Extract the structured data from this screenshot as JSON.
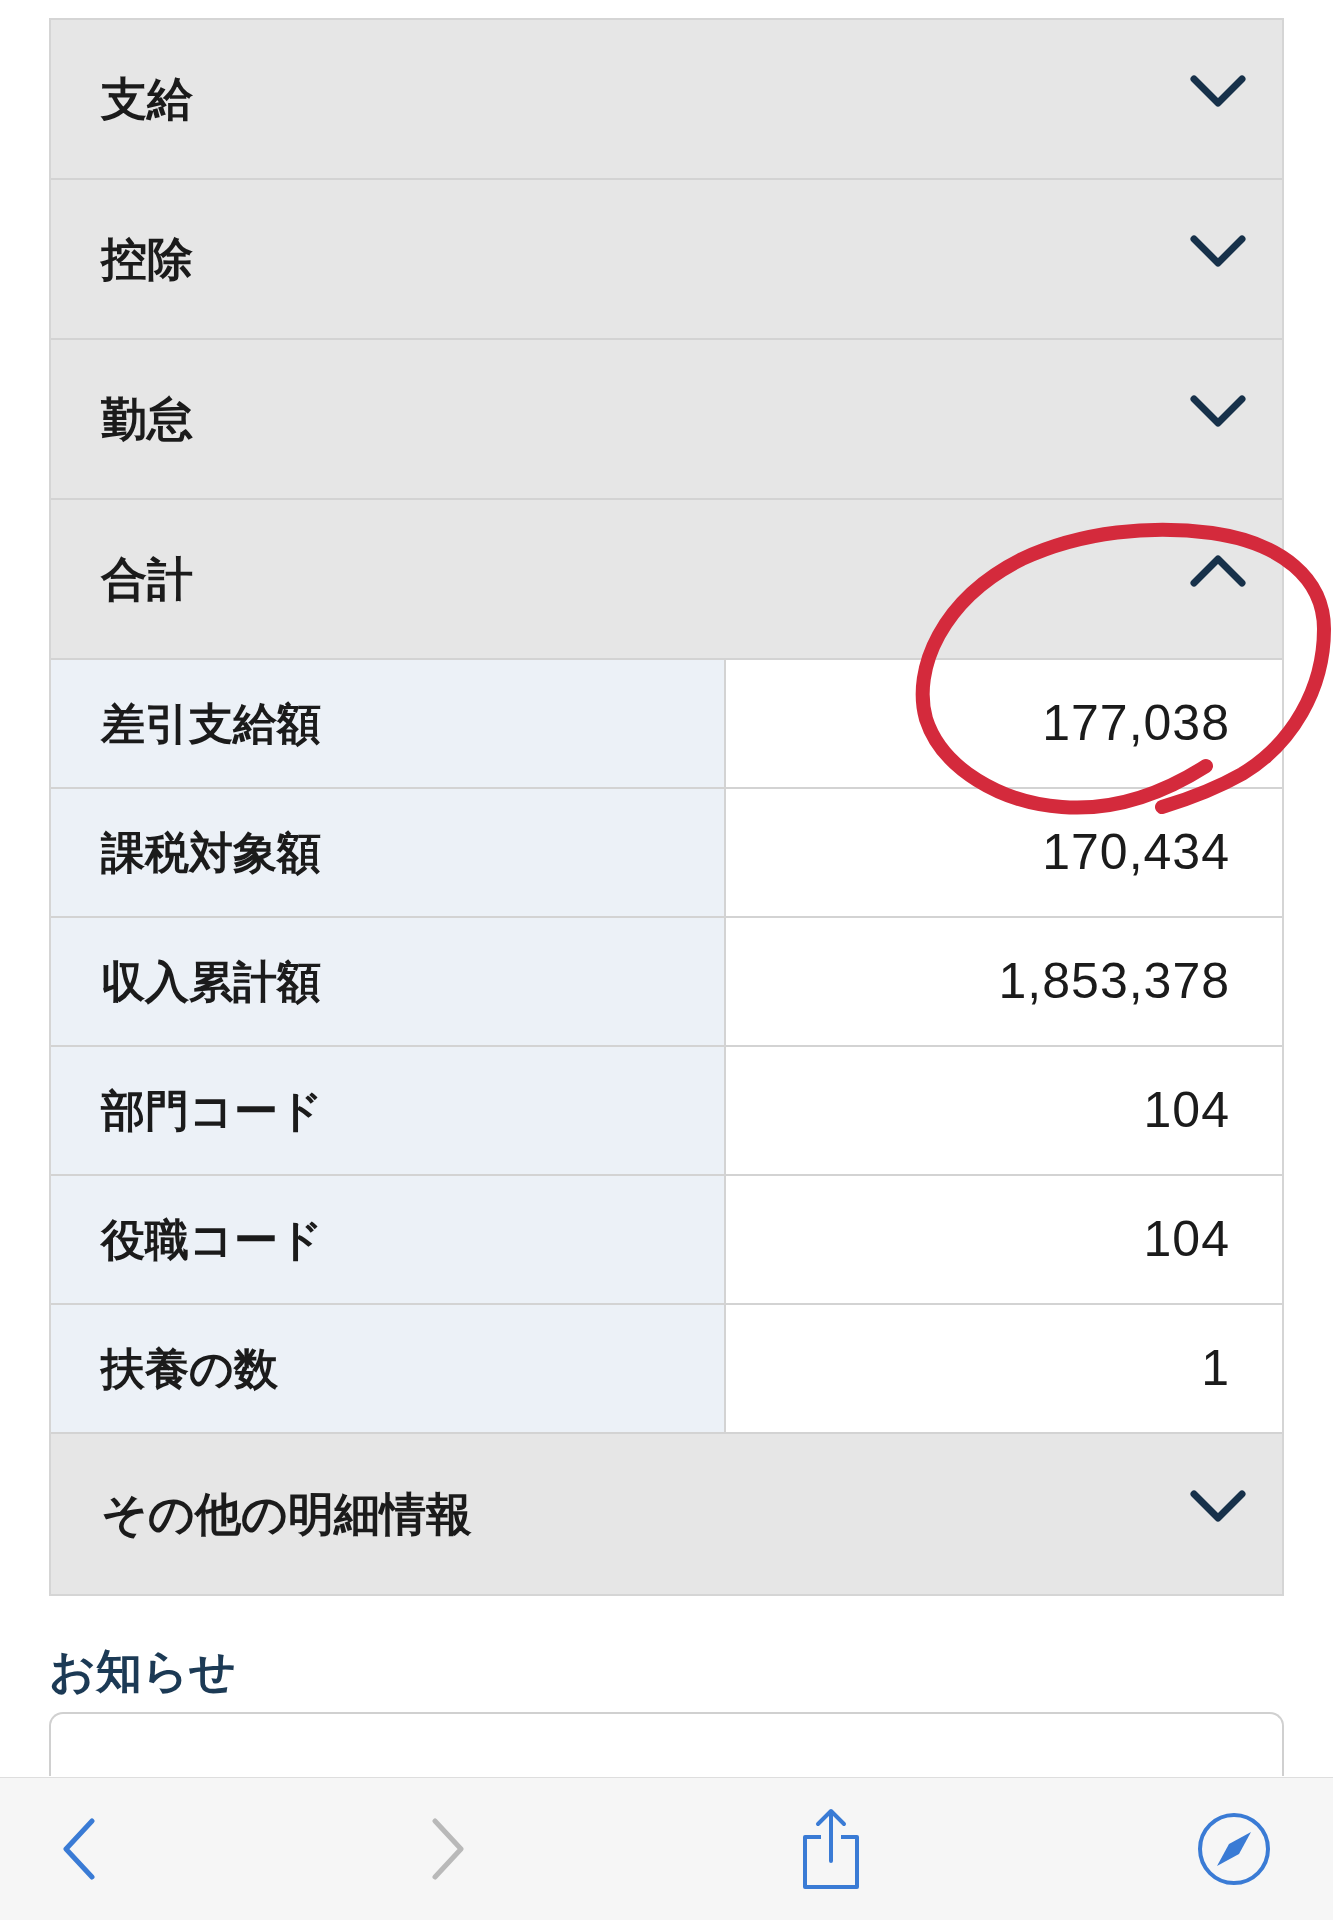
{
  "sections": [
    {
      "title": "支給",
      "expanded": false
    },
    {
      "title": "控除",
      "expanded": false
    },
    {
      "title": "勤怠",
      "expanded": false
    },
    {
      "title": "合計",
      "expanded": true,
      "rows": [
        {
          "label": "差引支給額",
          "value": "177,038",
          "circled": true
        },
        {
          "label": "課税対象額",
          "value": "170,434",
          "circled": false
        },
        {
          "label": "収入累計額",
          "value": "1,853,378",
          "circled": false
        },
        {
          "label": "部門コード",
          "value": "104",
          "circled": false
        },
        {
          "label": "役職コード",
          "value": "104",
          "circled": false
        },
        {
          "label": "扶養の数",
          "value": "1",
          "circled": false
        }
      ]
    },
    {
      "title": "その他の明細情報",
      "expanded": false
    }
  ],
  "notice": {
    "title": "お知らせ"
  },
  "toolbar": {
    "items": [
      {
        "kind": "back",
        "disabled": false
      },
      {
        "kind": "forward",
        "disabled": true
      },
      {
        "kind": "share",
        "disabled": false
      },
      {
        "kind": "compass",
        "disabled": false
      }
    ]
  }
}
